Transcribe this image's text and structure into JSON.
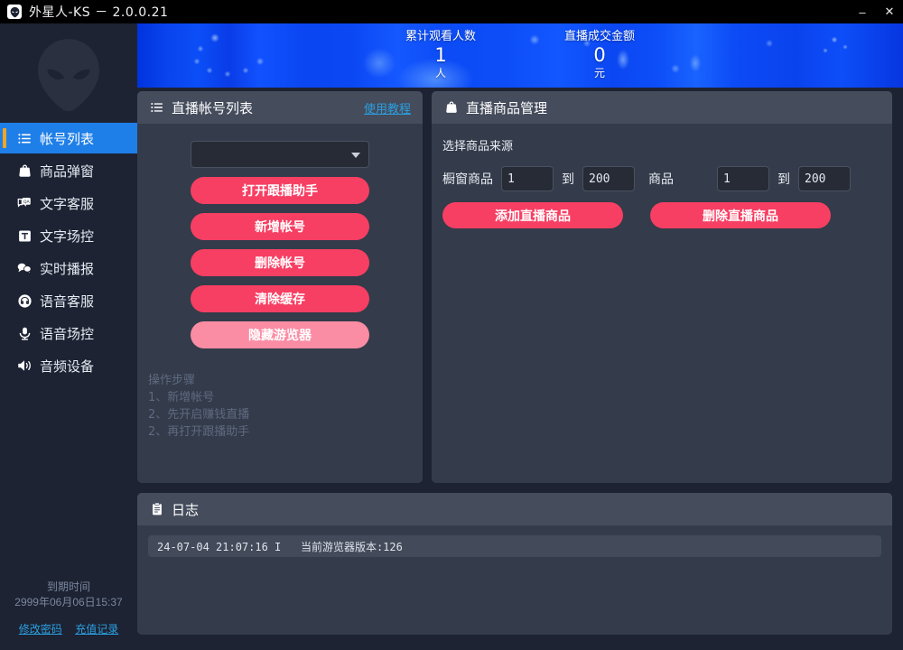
{
  "window": {
    "title": "外星人-KS － 2.0.0.21",
    "icon": "alien-icon",
    "minimize_label": "–",
    "close_label": "✕"
  },
  "sidebar": {
    "logo": "alien-logo",
    "items": [
      {
        "label": "帐号列表",
        "icon": "list-icon",
        "active": true
      },
      {
        "label": "商品弹窗",
        "icon": "bag-icon",
        "active": false
      },
      {
        "label": "文字客服",
        "icon": "chat-qa-icon",
        "active": false
      },
      {
        "label": "文字场控",
        "icon": "text-t-icon",
        "active": false
      },
      {
        "label": "实时播报",
        "icon": "bubbles-icon",
        "active": false
      },
      {
        "label": "语音客服",
        "icon": "headset-icon",
        "active": false
      },
      {
        "label": "语音场控",
        "icon": "microphone-icon",
        "active": false
      },
      {
        "label": "音频设备",
        "icon": "speaker-icon",
        "active": false
      }
    ],
    "expiry": {
      "label": "到期时间",
      "value": "2999年06月06日15:37",
      "links": [
        {
          "label": "修改密码"
        },
        {
          "label": "充值记录"
        }
      ]
    }
  },
  "banner": {
    "stats": [
      {
        "title": "累计观看人数",
        "value": "1",
        "unit": "人"
      },
      {
        "title": "直播成交金额",
        "value": "0",
        "unit": "元"
      }
    ]
  },
  "accounts_panel": {
    "icon": "list-icon",
    "title": "直播帐号列表",
    "tutorial_link": "使用教程",
    "account_select": {
      "value": "",
      "placeholder": "",
      "caret": "chevron-down-icon"
    },
    "buttons": [
      {
        "label": "打开跟播助手",
        "style": "solid"
      },
      {
        "label": "新增帐号",
        "style": "solid"
      },
      {
        "label": "删除帐号",
        "style": "solid"
      },
      {
        "label": "清除缓存",
        "style": "solid"
      },
      {
        "label": "隐藏游览器",
        "style": "light"
      }
    ],
    "steps": [
      "操作步骤",
      "1、新增帐号",
      "2、先开启赚钱直播",
      "2、再打开跟播助手"
    ]
  },
  "goods_panel": {
    "icon": "bag-icon",
    "title": "直播商品管理",
    "source_label": "选择商品来源",
    "ranges": [
      {
        "label": "橱窗商品",
        "from": "1",
        "to_label": "到",
        "to": "200"
      },
      {
        "label": "商品",
        "from": "1",
        "to_label": "到",
        "to": "200"
      }
    ],
    "buttons": [
      {
        "label": "添加直播商品"
      },
      {
        "label": "删除直播商品"
      }
    ]
  },
  "log_panel": {
    "icon": "clipboard-icon",
    "title": "日志",
    "lines": [
      "24-07-04 21:07:16 I   当前游览器版本:126"
    ]
  },
  "colors": {
    "accent_pink": "#f73f63",
    "accent_pink_light": "#fa8ca4",
    "active_blue": "#1f7fe8",
    "accent_orange": "#f5a524",
    "link_blue": "#2a9fe0",
    "panel_bg": "#343b4a",
    "panel_head_bg": "#454c5c",
    "app_bg": "#1d2333"
  }
}
